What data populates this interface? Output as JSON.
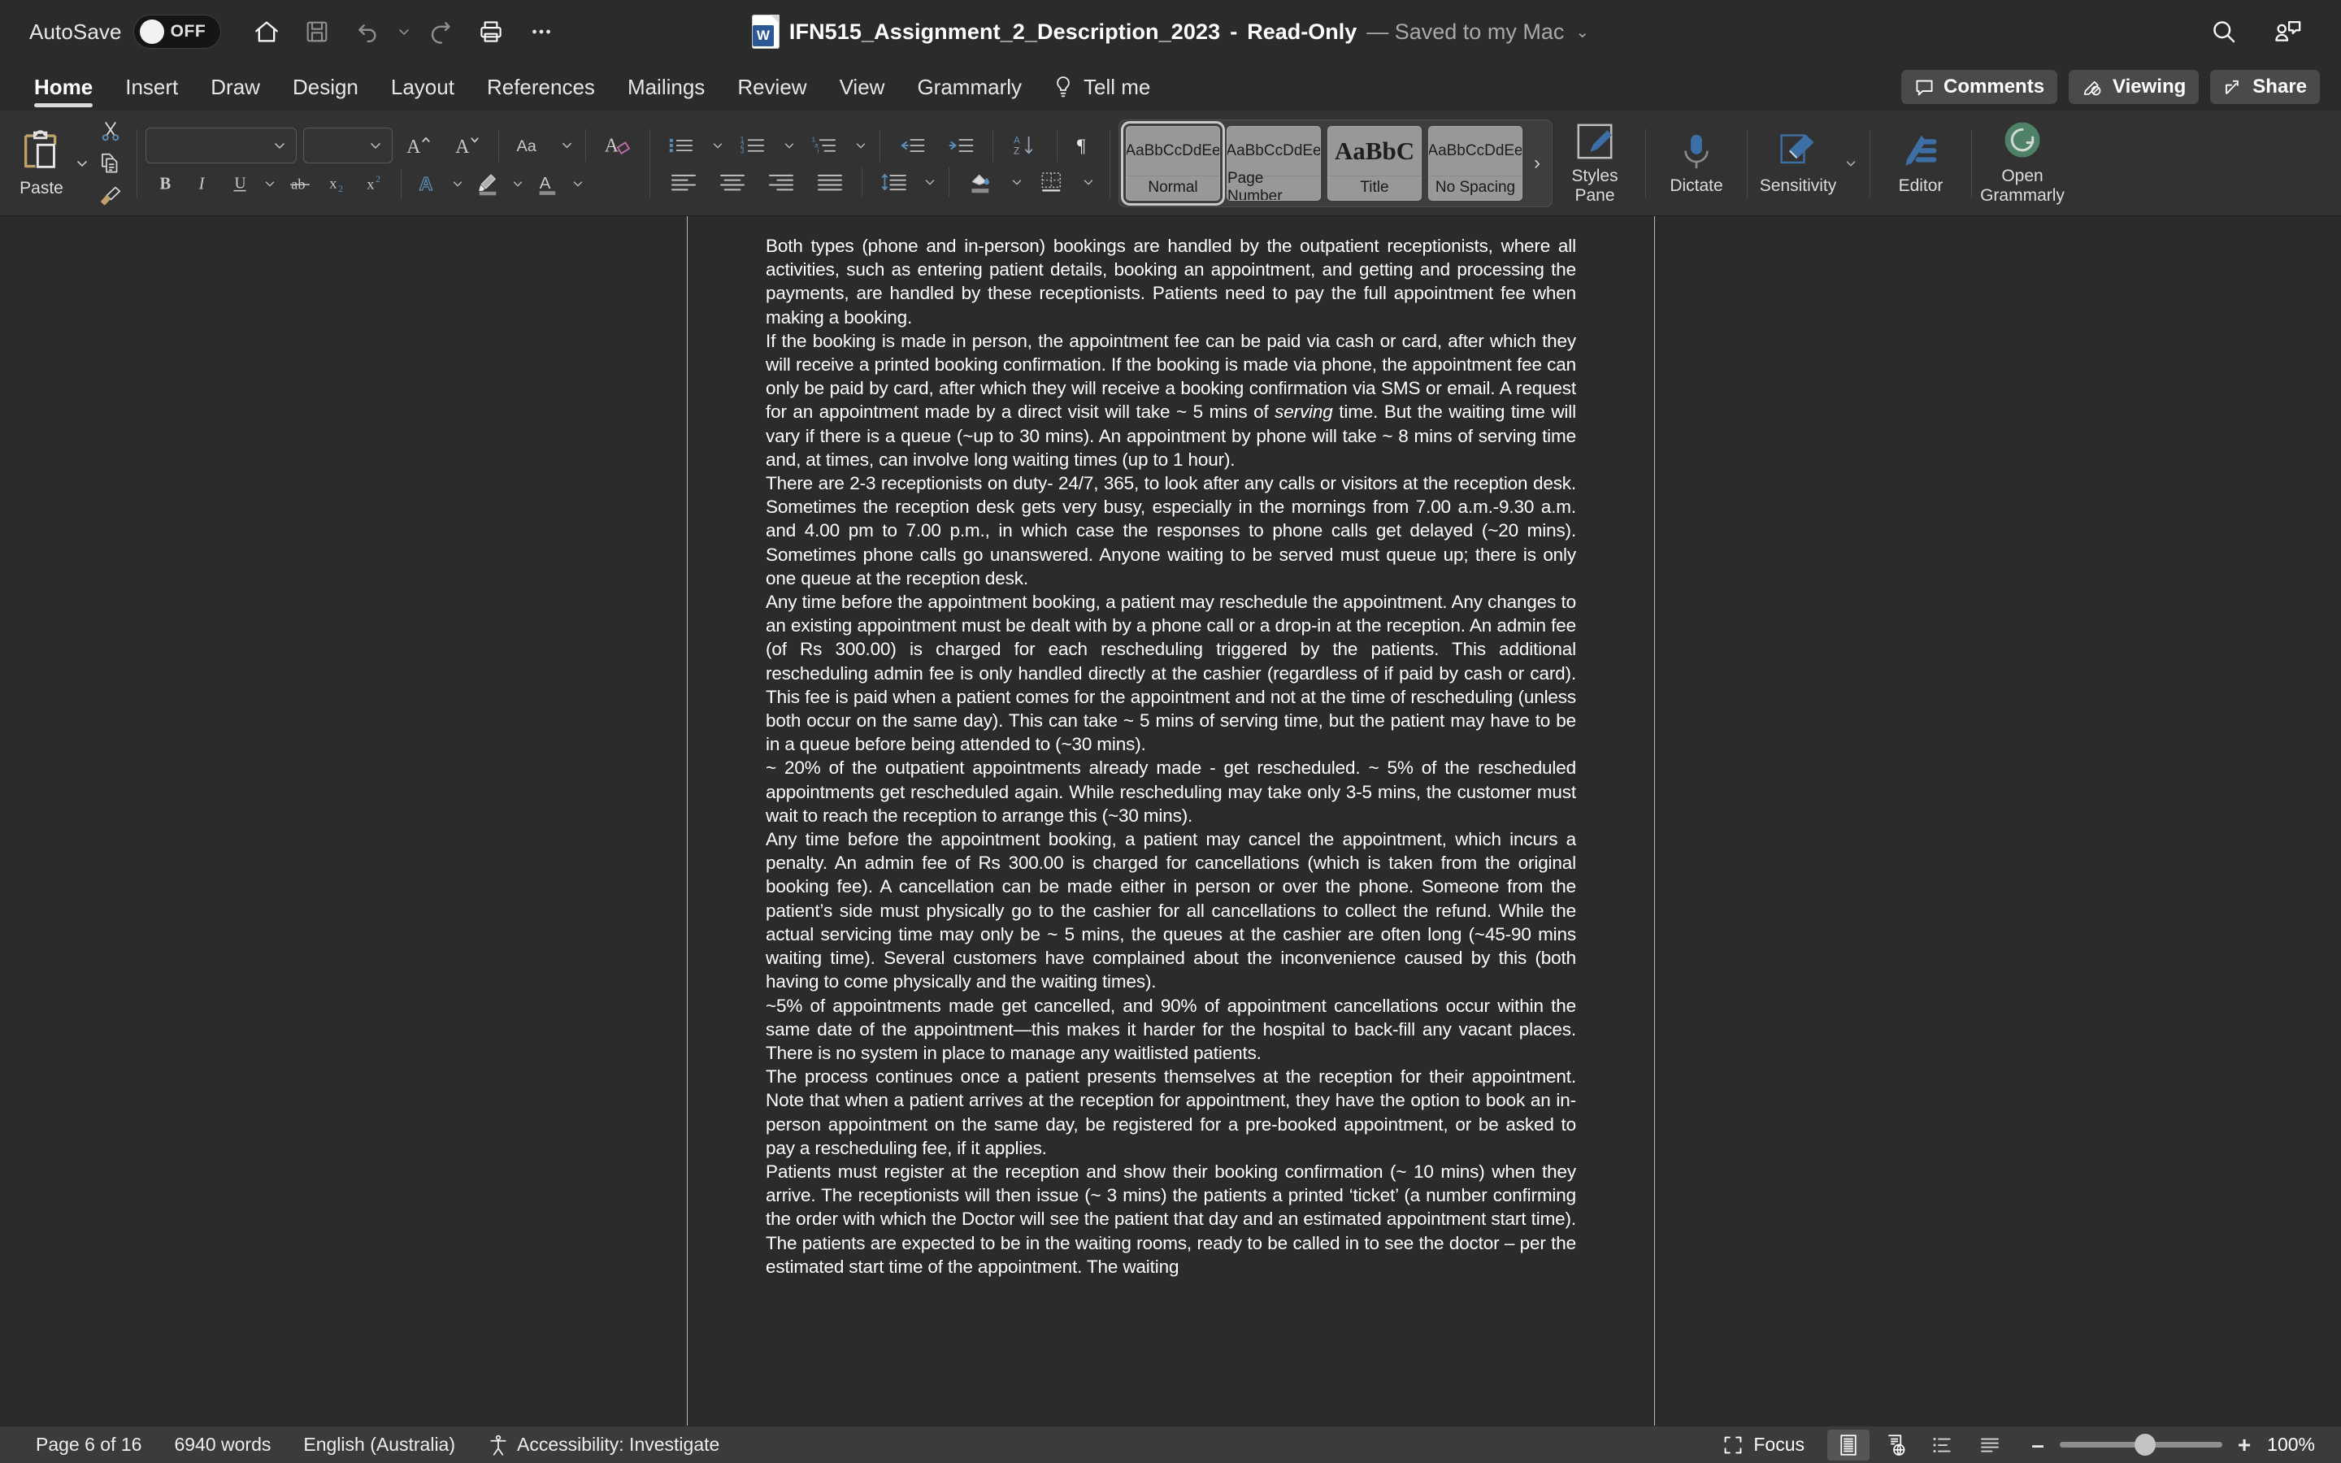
{
  "titlebar": {
    "autosave_label": "AutoSave",
    "autosave_state": "OFF",
    "doc_name": "IFN515_Assignment_2_Description_2023",
    "separator": "-",
    "readonly": "Read-Only",
    "saved_status": "— Saved to my Mac",
    "chevron": "⌄",
    "quick_access": [
      {
        "name": "home-icon",
        "label": "Home"
      },
      {
        "name": "save-icon",
        "label": "Save"
      },
      {
        "name": "undo-icon",
        "label": "Undo"
      },
      {
        "name": "undo-chevron-icon",
        "label": "Undo options"
      },
      {
        "name": "redo-icon",
        "label": "Redo"
      },
      {
        "name": "print-icon",
        "label": "Print"
      },
      {
        "name": "more-icon",
        "label": "More"
      }
    ],
    "right_icons": [
      {
        "name": "search-icon",
        "label": "Search"
      },
      {
        "name": "collaborators-icon",
        "label": "Collaborators"
      }
    ]
  },
  "tabs": [
    {
      "label": "Home",
      "active": true
    },
    {
      "label": "Insert",
      "active": false
    },
    {
      "label": "Draw",
      "active": false
    },
    {
      "label": "Design",
      "active": false
    },
    {
      "label": "Layout",
      "active": false
    },
    {
      "label": "References",
      "active": false
    },
    {
      "label": "Mailings",
      "active": false
    },
    {
      "label": "Review",
      "active": false
    },
    {
      "label": "View",
      "active": false
    },
    {
      "label": "Grammarly",
      "active": false
    }
  ],
  "tellme": {
    "label": "Tell me",
    "icon": "lightbulb-icon"
  },
  "tabs_right": {
    "comments": "Comments",
    "viewing": "Viewing",
    "share": "Share"
  },
  "ribbon": {
    "paste_label": "Paste",
    "font_name": "",
    "font_size": "",
    "font_name_placeholder": "",
    "font_size_placeholder": "",
    "buttons": {
      "cut": "Cut",
      "copy": "Copy",
      "format_painter": "Format Painter",
      "grow_font": "Grow Font",
      "shrink_font": "Shrink Font",
      "change_case": "Change Case",
      "clear_formatting": "Clear All Formatting",
      "bold": "B",
      "italic": "I",
      "underline": "U",
      "strikethrough": "ab",
      "subscript": "x₂",
      "superscript": "x²",
      "text_effects": "Text Effects",
      "highlight": "Text Highlight Color",
      "font_color": "Font Color",
      "bullets": "Bullets",
      "numbering": "Numbering",
      "multilevel": "Multilevel List",
      "decrease_indent": "Decrease Indent",
      "increase_indent": "Increase Indent",
      "sort": "Sort",
      "show_marks": "Show/Hide ¶",
      "align_left": "Align Left",
      "align_center": "Center",
      "align_right": "Align Right",
      "justify": "Justify",
      "line_spacing": "Line Spacing",
      "shading": "Shading",
      "borders": "Borders"
    },
    "styles": [
      {
        "preview": "AaBbCcDdEe",
        "name": "Normal",
        "selected": true,
        "variant": "normal"
      },
      {
        "preview": "AaBbCcDdEe",
        "name": "Page Number",
        "selected": false,
        "variant": "normal"
      },
      {
        "preview": "AaBbC",
        "name": "Title",
        "selected": false,
        "variant": "title"
      },
      {
        "preview": "AaBbCcDdEe",
        "name": "No Spacing",
        "selected": false,
        "variant": "normal"
      }
    ],
    "gallery_more": "›",
    "styles_pane": "Styles\nPane",
    "styles_pane_line1": "Styles",
    "styles_pane_line2": "Pane",
    "dictate": "Dictate",
    "sensitivity": "Sensitivity",
    "editor": "Editor",
    "grammarly_line1": "Open",
    "grammarly_line2": "Grammarly",
    "grammarly_color": "#4f8068"
  },
  "document": {
    "paragraphs": [
      "Both types (phone and in-person) bookings are handled by the outpatient receptionists, where all activities, such as entering patient details, booking an appointment, and getting and processing the payments, are handled by these receptionists. Patients need to pay the full appointment fee when making a booking.",
      "If the booking is made in person, the appointment fee can be paid via cash or card, after which they will receive a printed booking confirmation. If the booking is made via phone, the appointment fee can only be paid by card, after which they will receive a booking confirmation via SMS or email. A request for an appointment made by a direct visit will take ~ 5 mins of <em>serving</em> time. But the waiting time will vary if there is a queue (~up to 30 mins). An appointment by phone will take ~ 8 mins of serving time and, at times, can involve long waiting times (up to 1 hour).",
      "There are 2-3 receptionists on duty- 24/7, 365, to look after any calls or visitors at the reception desk. Sometimes the reception desk gets very busy, especially in the mornings from 7.00 a.m.-9.30 a.m. and 4.00 pm to 7.00 p.m., in which case the responses to phone calls get delayed (~20 mins). Sometimes phone calls go unanswered. Anyone waiting to be served must queue up; there is only one queue at the reception desk.",
      "Any time before the appointment booking, a patient may reschedule the appointment. Any changes to an existing appointment must be dealt with by a phone call or a drop-in at the reception. An admin fee (of Rs 300.00) is charged for each rescheduling triggered by the patients. This additional rescheduling admin fee is only handled directly at the cashier (regardless of if paid by cash or card). This fee is paid when a patient comes for the appointment and not at the time of rescheduling (unless both occur on the same day). This can take ~ 5 mins of serving time, but the patient may have to be in a queue before being attended to (~30 mins).",
      "~ 20% of the outpatient appointments already made - get rescheduled. ~ 5% of the rescheduled appointments get rescheduled again. While rescheduling may take only 3-5 mins, the customer must wait to reach the reception to arrange this (~30 mins).",
      "Any time before the appointment booking, a patient may cancel the appointment, which incurs a penalty. An admin fee of Rs 300.00 is charged for cancellations (which is taken from the original booking fee). A cancellation can be made either in person or over the phone. Someone from the patient’s side must physically go to the cashier for all cancellations to collect the refund. While the actual servicing time may only be ~ 5 mins, the queues at the cashier are often long (~45-90 mins waiting time). Several customers have complained about the inconvenience caused by this (both having to come physically and the waiting times).",
      "~5% of appointments made get cancelled, and 90% of appointment cancellations occur within the same date of the appointment—this makes it harder for the hospital to back-fill any vacant places. There is no system in place to manage any waitlisted patients.",
      "The process continues once a patient presents themselves at the reception for their appointment.  Note that when a patient arrives at the reception for appointment, they have the option to book an in-person appointment on the same day, be registered for a pre-booked appointment, or be asked to pay a rescheduling fee, if it applies.",
      "Patients must register at the reception and show their booking confirmation (~ 10 mins) when they arrive. The receptionists will then issue (~ 3 mins) the patients a printed ‘ticket’ (a number confirming the order with which the Doctor will see the patient that day and an estimated appointment start time). The patients are expected to be in the waiting rooms, ready to be called in to see the doctor – per the estimated start time of the appointment. The waiting"
    ]
  },
  "statusbar": {
    "page": "Page 6 of 16",
    "words": "6940 words",
    "language": "English (Australia)",
    "accessibility": "Accessibility: Investigate",
    "focus": "Focus",
    "zoom_minus": "–",
    "zoom_plus": "+",
    "zoom_value": "100%",
    "views": [
      {
        "name": "print-layout-view",
        "active": true
      },
      {
        "name": "web-layout-view",
        "active": false
      },
      {
        "name": "outline-view",
        "active": false
      },
      {
        "name": "draft-view",
        "active": false
      }
    ]
  }
}
